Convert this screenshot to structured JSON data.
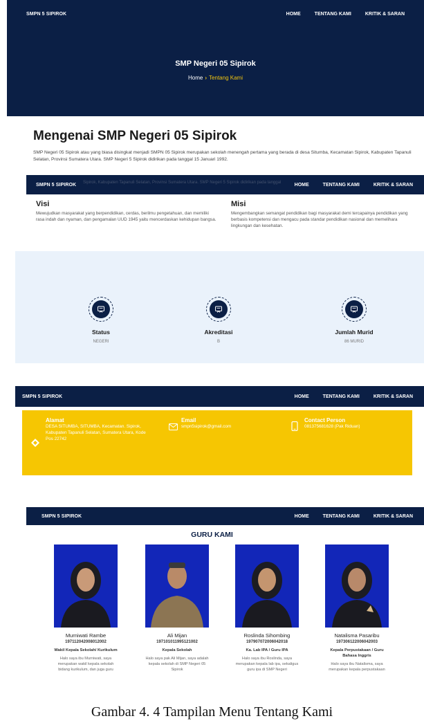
{
  "nav": {
    "brand": "SMPN 5 SIPIROK",
    "home": "HOME",
    "about": "TENTANG KAMI",
    "feedback": "KRITIK & SARAN"
  },
  "hero": {
    "title": "SMP Negeri 05 Sipirok",
    "crumb_home": "Home",
    "crumb_sep": "›",
    "crumb_current": "Tentang Kami"
  },
  "about": {
    "title": "Mengenai SMP Negeri 05 Sipirok",
    "body": "SMP Negeri 05 Sipirok atau yang biasa disingkat menjadi SMPN 05 Sipirok merupakan sekolah menengah pertama yang berada di desa Situmba, Kecamatan Sipirok, Kabupaten Tapanuli Selatan, Provinsi Sumatera Utara. SMP Negeri 5 Sipirok didirikan pada tanggal 15 Januari 1992.",
    "faint_text": "Sipirok, Kabupaten Tapanuli Selatan, Provinsi Sumatera Utara. SMP Negeri 5 Sipirok didirikan pada tanggal"
  },
  "visi": {
    "title": "Visi",
    "body": "Mewujudkan masyarakat yang berpendidikan, cerdas, berilmu pengetahuan, dan memiliki rasa indah dan nyaman, dan pengamalan UUD 1945 yaitu mencerdaskan kehidupan bangsa."
  },
  "misi": {
    "title": "Misi",
    "body": "Mengembangkan semangat pendidikan bagi masyarakat demi tercapainya pendidikan yang berbasis kompetensi dan mengacu pada standar pendidikan nasional dan memelihara lingkungan dan kesehatan."
  },
  "stats": [
    {
      "label": "Status",
      "value": "NEGERI"
    },
    {
      "label": "Akreditasi",
      "value": "B"
    },
    {
      "label": "Jumlah Murid",
      "value": "86 MURID"
    }
  ],
  "contact": {
    "address_title": "Alamat",
    "address": "DESA SITUMBA, SITUMBA, Kecamatan. Sipirok, Kabupaten Tapanuli Selatan, Sumatera Utara, Kode Pos 22742",
    "email_title": "Email",
    "email": "smpn5sipirok@gmail.com",
    "phone_title": "Contact Person",
    "phone": "081375681628 (Pak Riduan)"
  },
  "guru": {
    "title": "GURU KAMI",
    "teachers": [
      {
        "name": "Murniwati Rambe",
        "nip": "197112042008012002",
        "role": "Wakil Kepala Sekolah/ Kurikulum",
        "bio": "Halo saya ibu Murniwati, saya merupakan wakil kepala sekolah bidang kurikulum, dan juga guru"
      },
      {
        "name": "Ali Mijan",
        "nip": "197101011995121002",
        "role": "Kepala Sekolah",
        "bio": "Halo saya pak Ali Mijan, saya adalah kepala sekolah di SMP Negeri 05 Sipirok"
      },
      {
        "name": "Roslinda Sihombing",
        "nip": "197907072006042018",
        "role": "Ka. Lab IPA / Guru IPA",
        "bio": "Halo saya ibu Roslinda, saya merupakan kepala lab ipa, sekaligus guru ipa di SMP Negeri"
      },
      {
        "name": "Natalisma Pasaribu",
        "nip": "197306122006042003",
        "role": "Kepala Perpustakaan / Guru Bahasa Inggris",
        "bio": "Halo saya ibu Natalisma, saya merupakan kepala perpustakaan"
      }
    ]
  },
  "caption": "Gambar 4. 4 Tampilan Menu Tentang Kami"
}
